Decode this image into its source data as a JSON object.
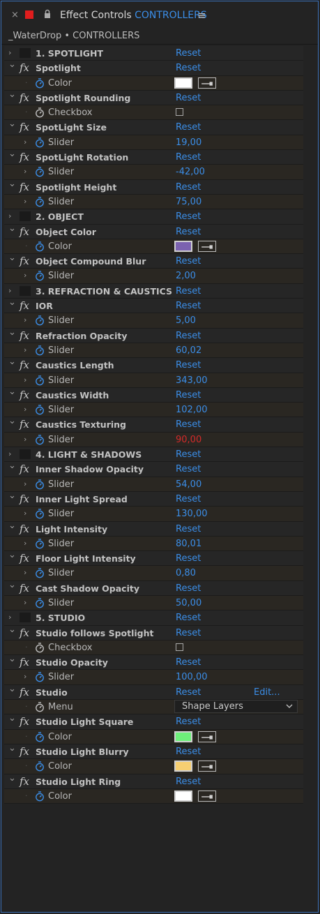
{
  "header": {
    "close": "×",
    "title_prefix": "Effect Controls",
    "title_accent": "CONTROLLERS",
    "menu": "≡"
  },
  "subtitle": "_WaterDrop • CONTROLLERS",
  "colors": {
    "accent": "#3b8ee8",
    "alert": "#d42a2a"
  },
  "rows": [
    {
      "kind": "group",
      "name": "1. SPOTLIGHT",
      "action": "Reset"
    },
    {
      "kind": "effect",
      "name": "Spotlight",
      "action": "Reset"
    },
    {
      "kind": "color",
      "name": "Color",
      "color": "#ffffff"
    },
    {
      "kind": "effect",
      "name": "Spotlight Rounding",
      "action": "Reset"
    },
    {
      "kind": "checkbox",
      "name": "Checkbox"
    },
    {
      "kind": "effect",
      "name": "SpotLight Size",
      "action": "Reset"
    },
    {
      "kind": "slider",
      "name": "Slider",
      "value": "19,00"
    },
    {
      "kind": "effect",
      "name": "SpotLight Rotation",
      "action": "Reset"
    },
    {
      "kind": "slider",
      "name": "Slider",
      "value": "-42,00"
    },
    {
      "kind": "effect",
      "name": "Spotlight Height",
      "action": "Reset"
    },
    {
      "kind": "slider",
      "name": "Slider",
      "value": "75,00"
    },
    {
      "kind": "group",
      "name": "2. OBJECT",
      "action": "Reset"
    },
    {
      "kind": "effect",
      "name": "Object Color",
      "action": "Reset"
    },
    {
      "kind": "color",
      "name": "Color",
      "color": "#7b62b0"
    },
    {
      "kind": "effect",
      "name": "Object Compound Blur",
      "action": "Reset"
    },
    {
      "kind": "slider",
      "name": "Slider",
      "value": "2,00"
    },
    {
      "kind": "group",
      "name": "3. REFRACTION & CAUSTICS",
      "action": "Reset"
    },
    {
      "kind": "effect",
      "name": "IOR",
      "action": "Reset"
    },
    {
      "kind": "slider",
      "name": "Slider",
      "value": "5,00"
    },
    {
      "kind": "effect",
      "name": "Refraction Opacity",
      "action": "Reset"
    },
    {
      "kind": "slider",
      "name": "Slider",
      "value": "60,02"
    },
    {
      "kind": "effect",
      "name": "Caustics Length",
      "action": "Reset"
    },
    {
      "kind": "slider",
      "name": "Slider",
      "value": "343,00"
    },
    {
      "kind": "effect",
      "name": "Caustics Width",
      "action": "Reset"
    },
    {
      "kind": "slider",
      "name": "Slider",
      "value": "102,00"
    },
    {
      "kind": "effect",
      "name": "Caustics Texturing",
      "action": "Reset"
    },
    {
      "kind": "slider",
      "name": "Slider",
      "value": "90,00",
      "alert": true
    },
    {
      "kind": "group",
      "name": "4. LIGHT & SHADOWS",
      "action": "Reset"
    },
    {
      "kind": "effect",
      "name": "Inner Shadow Opacity",
      "action": "Reset"
    },
    {
      "kind": "slider",
      "name": "Slider",
      "value": "54,00"
    },
    {
      "kind": "effect",
      "name": "Inner Light Spread",
      "action": "Reset"
    },
    {
      "kind": "slider",
      "name": "Slider",
      "value": "130,00"
    },
    {
      "kind": "effect",
      "name": "Light Intensity",
      "action": "Reset"
    },
    {
      "kind": "slider",
      "name": "Slider",
      "value": "80,01"
    },
    {
      "kind": "effect",
      "name": "Floor Light Intensity",
      "action": "Reset"
    },
    {
      "kind": "slider",
      "name": "Slider",
      "value": "0,80"
    },
    {
      "kind": "effect",
      "name": "Cast Shadow Opacity",
      "action": "Reset"
    },
    {
      "kind": "slider",
      "name": "Slider",
      "value": "50,00"
    },
    {
      "kind": "group",
      "name": "5. STUDIO",
      "action": "Reset"
    },
    {
      "kind": "effect",
      "name": "Studio follows Spotlight",
      "action": "Reset"
    },
    {
      "kind": "checkbox",
      "name": "Checkbox"
    },
    {
      "kind": "effect",
      "name": "Studio Opacity",
      "action": "Reset"
    },
    {
      "kind": "slider",
      "name": "Slider",
      "value": "100,00"
    },
    {
      "kind": "effect",
      "name": "Studio",
      "action": "Reset",
      "edit": "Edit..."
    },
    {
      "kind": "menu",
      "name": "Menu",
      "value": "Shape Layers"
    },
    {
      "kind": "effect",
      "name": "Studio Light Square",
      "action": "Reset"
    },
    {
      "kind": "color",
      "name": "Color",
      "color": "#6ef07a"
    },
    {
      "kind": "effect",
      "name": "Studio Light Blurry",
      "action": "Reset"
    },
    {
      "kind": "color",
      "name": "Color",
      "color": "#f6cf72"
    },
    {
      "kind": "effect",
      "name": "Studio Light Ring",
      "action": "Reset"
    },
    {
      "kind": "color",
      "name": "Color",
      "color": "#ffffff"
    }
  ]
}
